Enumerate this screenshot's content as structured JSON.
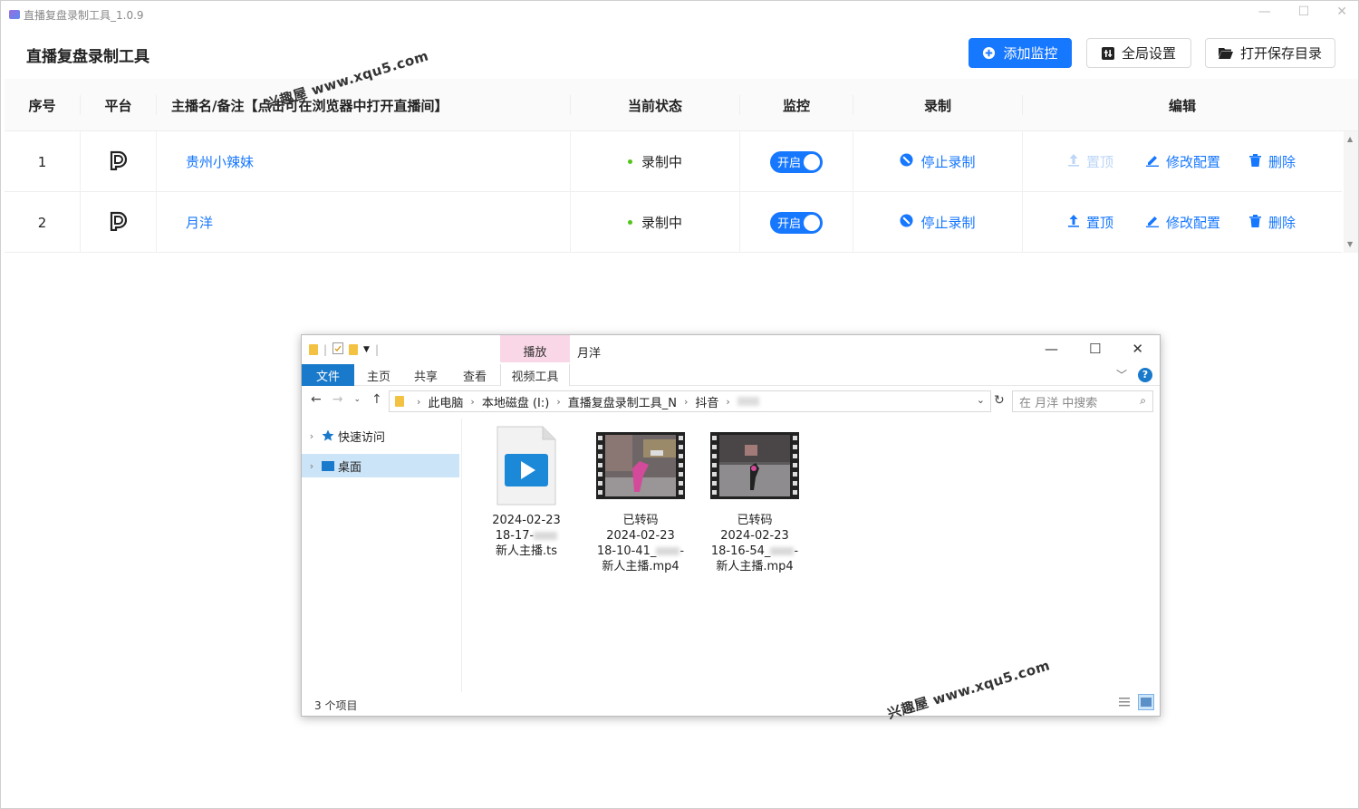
{
  "window": {
    "title": "直播复盘录制工具_1.0.9",
    "controls": [
      "—",
      "☐",
      "✕"
    ]
  },
  "header": {
    "app_name": "直播复盘录制工具",
    "add_monitor_label": "添加监控",
    "global_settings_label": "全局设置",
    "open_folder_label": "打开保存目录",
    "accent_color": "#1677ff"
  },
  "table": {
    "columns": [
      "序号",
      "平台",
      "主播名/备注【点击可在浏览器中打开直播间】",
      "当前状态",
      "监控",
      "录制",
      "编辑"
    ],
    "rows": [
      {
        "index": "1",
        "platform_icon": "douyin-icon",
        "name": "贵州小辣妹",
        "status": "录制中",
        "monitor": "开启",
        "record_action": "停止录制",
        "pin": "置顶",
        "pin_enabled": false,
        "edit": "修改配置",
        "delete": "删除"
      },
      {
        "index": "2",
        "platform_icon": "douyin-icon",
        "name": "月洋",
        "status": "录制中",
        "monitor": "开启",
        "record_action": "停止录制",
        "pin": "置顶",
        "pin_enabled": true,
        "edit": "修改配置",
        "delete": "删除"
      }
    ]
  },
  "watermark": "兴趣屋 www.xqu5.com",
  "explorer": {
    "title": "月洋",
    "contextual_tab": "播放",
    "ribbon_tabs": [
      "文件",
      "主页",
      "共享",
      "查看",
      "视频工具"
    ],
    "breadcrumb": [
      "此电脑",
      "本地磁盘 (I:)",
      "直播复盘录制工具_N",
      "抖音"
    ],
    "search_placeholder": "在 月洋 中搜索",
    "nav_items": [
      "快速访问",
      "桌面"
    ],
    "files": [
      {
        "line1": "2024-02-23",
        "line2": "18-17-",
        "line3": "新人主播.ts",
        "type": "ts-video-icon"
      },
      {
        "line1": "已转码",
        "line2": "2024-02-23",
        "line3": "18-10-41_",
        "line4": "新人主播.mp4",
        "type": "video-thumbnail"
      },
      {
        "line1": "已转码",
        "line2": "2024-02-23",
        "line3": "18-16-54_",
        "line4": "新人主播.mp4",
        "type": "video-thumbnail"
      }
    ],
    "status_text": "3 个项目",
    "ribbon_color": "#1979ca",
    "contextual_color": "#f9d7e6"
  }
}
